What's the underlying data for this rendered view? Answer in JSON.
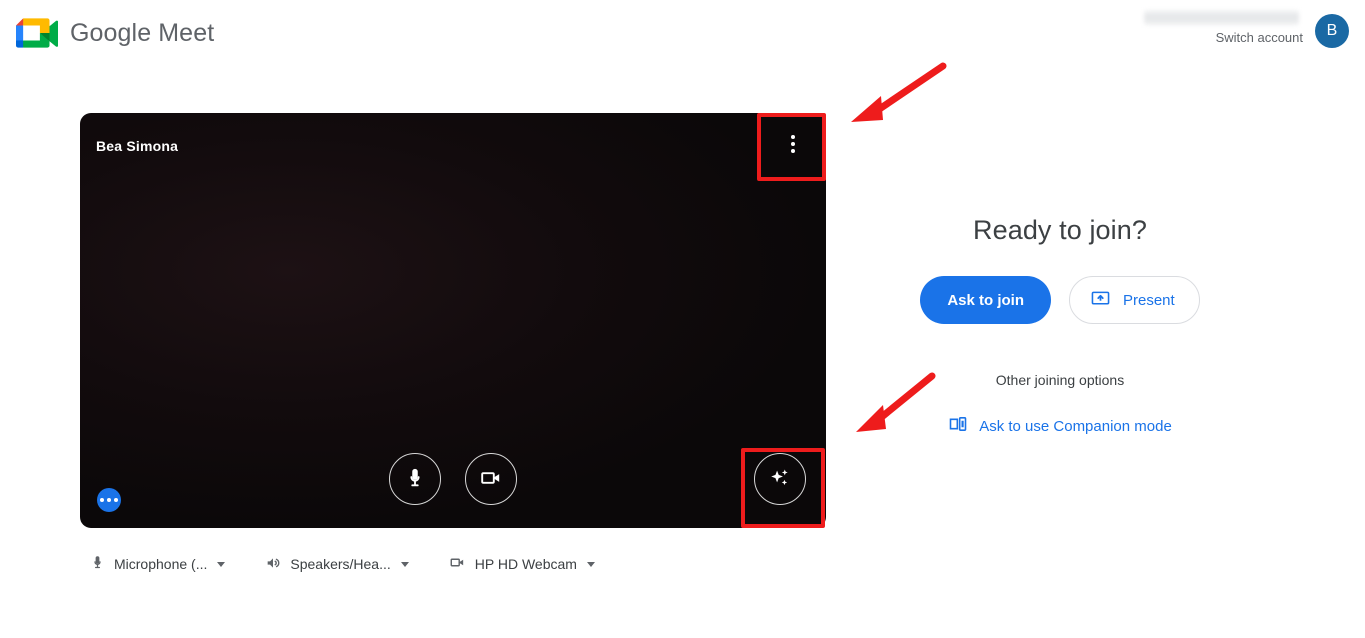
{
  "header": {
    "brand_name": "Google Meet",
    "logo_icon": "google-meet-logo",
    "account": {
      "email_redacted": "",
      "switch_account_label": "Switch account",
      "avatar_initial": "B",
      "avatar_color": "#1a69a4"
    }
  },
  "preview": {
    "self_name": "Bea Simona",
    "more_options_icon": "more-vertical-icon",
    "microphone_icon": "microphone-icon",
    "camera_icon": "video-camera-icon",
    "effects_icon": "sparkles-icon",
    "network_icon": "more-horizontal-icon",
    "background_color": "#0a0809"
  },
  "devices": [
    {
      "icon": "microphone-icon",
      "label": "Microphone (...",
      "name": "microphone-selector"
    },
    {
      "icon": "speaker-icon",
      "label": "Speakers/Hea...",
      "name": "speaker-selector"
    },
    {
      "icon": "video-camera-icon",
      "label": "HP HD Webcam",
      "name": "camera-selector"
    }
  ],
  "join_panel": {
    "title": "Ready to join?",
    "ask_to_join_label": "Ask to join",
    "present_label": "Present",
    "present_icon": "present-screen-icon",
    "other_options_label": "Other joining options",
    "companion_label": "Ask to use Companion mode",
    "companion_icon": "companion-device-icon",
    "accent_color": "#1a73e8"
  },
  "annotations": {
    "highlight_color": "#ee1c1c",
    "boxes": [
      {
        "name": "highlight-more-options",
        "target": "more-options-button"
      },
      {
        "name": "highlight-effects",
        "target": "effects-button"
      }
    ],
    "arrows": [
      {
        "name": "arrow-to-more-options"
      },
      {
        "name": "arrow-to-effects"
      }
    ]
  }
}
